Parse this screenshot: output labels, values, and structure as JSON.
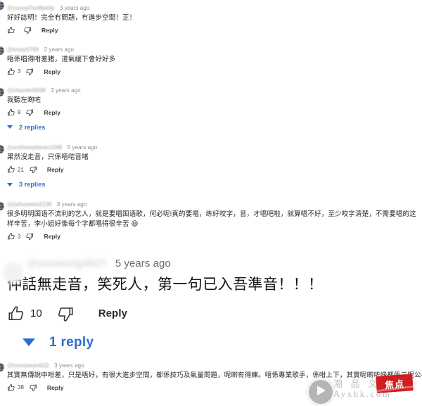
{
  "page": {
    "platform": "youtube-comments",
    "accent_blue": "#2c6fd1",
    "text_color": "#0f0f0f",
    "background": "#ffffff"
  },
  "labels": {
    "reply": "Reply",
    "like_icon": "thumbs-up-icon",
    "dislike_icon": "thumbs-down-icon",
    "caret_icon": "chevron-down-icon"
  },
  "comments": [
    {
      "username": "@xxxxp7ee8jw3p",
      "timestamp": "3 years ago",
      "text": "好好諗明！完全冇問題，冇進步空間！正！",
      "likes": "",
      "reply": "Reply",
      "replies": null
    },
    {
      "username": "@knoy0799",
      "timestamp": "2 years ago",
      "text": "唔係唱得咁差猪，道氣緩下會好好多",
      "likes": "3",
      "reply": "Reply",
      "replies": null
    },
    {
      "username": "@chaufei5038",
      "timestamp": "3 years ago",
      "text": "我聽左啲咗",
      "likes": "9",
      "reply": "Reply",
      "replies": "2 replies"
    },
    {
      "username": "@anthonykwan1349",
      "timestamp": "5 years ago",
      "text": "果然沒走音，只係唔啱音啫",
      "likes": "21",
      "reply": "Reply",
      "replies": "3 replies"
    },
    {
      "username": "@jiahuiwen2136",
      "timestamp": "3 years ago",
      "text": "很多明明国语不流利的艺人，就是要唱国语歌，何必呢!真的要唱，练好咬字，音，才唱吧啦，就算唱不好，至少咬字清楚，不需要唱的这样辛苦，李小姐好像每个字都唱得很辛苦 😄",
      "likes": "3",
      "reply": "Reply",
      "replies": null
    }
  ],
  "featured_comment": {
    "username": "@xxxwong4027",
    "timestamp": "5 years ago",
    "text": "仲話無走音，笑死人，第一句已入吾準音！！！",
    "likes": "10",
    "reply": "Reply",
    "replies": "1 reply"
  },
  "bottom_comment": {
    "username": "@tonnywan622",
    "timestamp": "3 years ago",
    "text": "其實無傳說中咁差，只是唔好，有很大進步空間，都係技巧及氣量問題，呢啲有得練。唔係專業歌手，係咁上下，其實呢啲咗緣都係二呢公養得咁話。",
    "likes": "38",
    "reply": "Reply",
    "replies": null
  },
  "watermark": {
    "chinese": "潮 品 文",
    "domain": "Ayxhk.com",
    "stamp": "焦点",
    "play_icon": "play-button-icon",
    "stamp_color": "#d01f1f"
  }
}
